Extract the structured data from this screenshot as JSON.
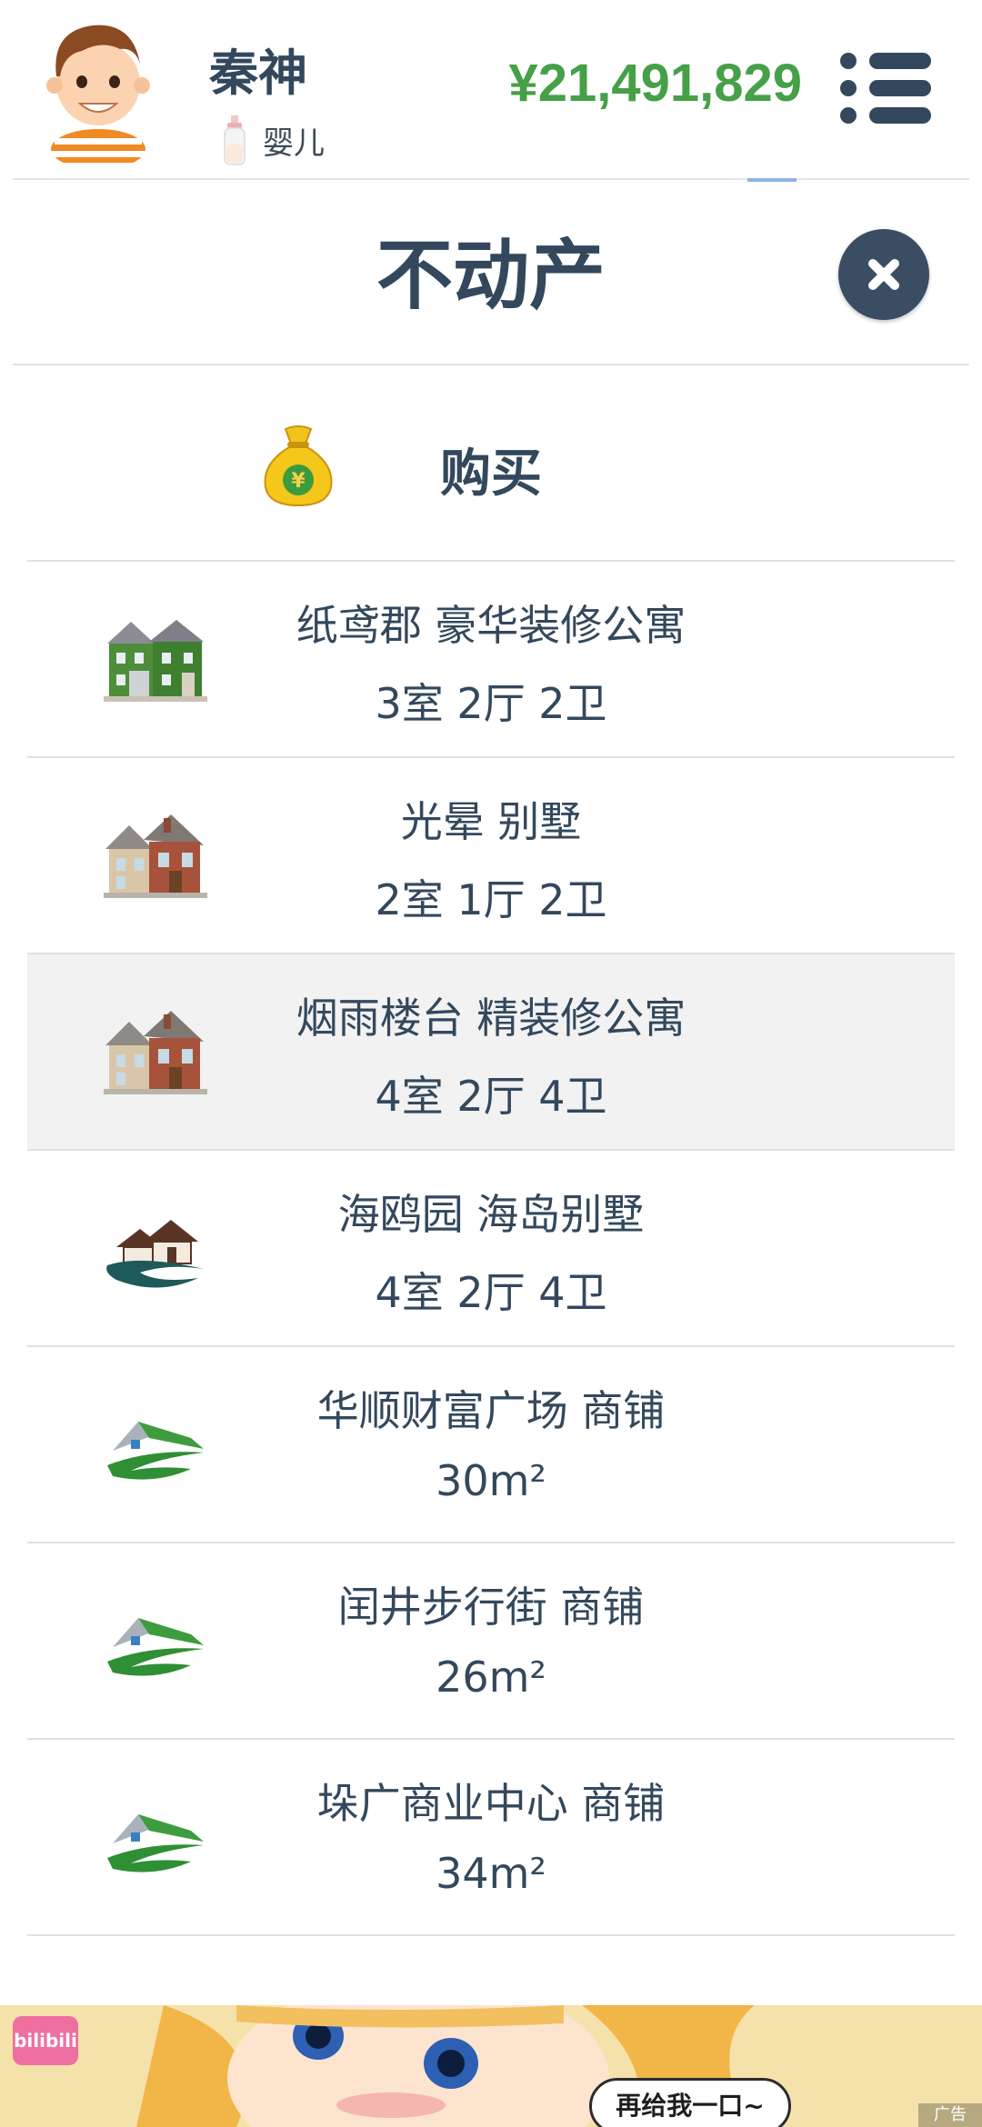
{
  "header": {
    "username": "秦神",
    "stage_label": "婴儿",
    "stage_icon": "baby-bottle-icon",
    "money": "¥21,491,829",
    "menu_icon": "list-menu-icon",
    "money_color": "#45a047"
  },
  "panel": {
    "title": "不动产",
    "close_icon": "close-icon"
  },
  "buy": {
    "label": "购买",
    "icon": "money-bag-icon"
  },
  "properties": [
    {
      "name": "纸鸢郡 豪华装修公寓",
      "detail": "3室 2厅 2卫",
      "icon": "green-house-icon",
      "selected": false
    },
    {
      "name": "光晕 别墅",
      "detail": "2室 1厅 2卫",
      "icon": "brick-house-icon",
      "selected": false
    },
    {
      "name": "烟雨楼台 精装修公寓",
      "detail": "4室 2厅 4卫",
      "icon": "brick-house-icon",
      "selected": true
    },
    {
      "name": "海鸥园 海岛别墅",
      "detail": "4室 2厅 4卫",
      "icon": "island-villa-icon",
      "selected": false
    },
    {
      "name": "华顺财富广场 商铺",
      "detail": "30m²",
      "icon": "shop-roof-icon",
      "selected": false
    },
    {
      "name": "闰井步行街 商铺",
      "detail": "26m²",
      "icon": "shop-roof-icon",
      "selected": false
    },
    {
      "name": "垛广商业中心 商铺",
      "detail": "34m²",
      "icon": "shop-roof-icon",
      "selected": false
    }
  ],
  "ad": {
    "logo_text": "bilibili",
    "bubble_text": "再给我一口~",
    "tag_text": "广告"
  }
}
